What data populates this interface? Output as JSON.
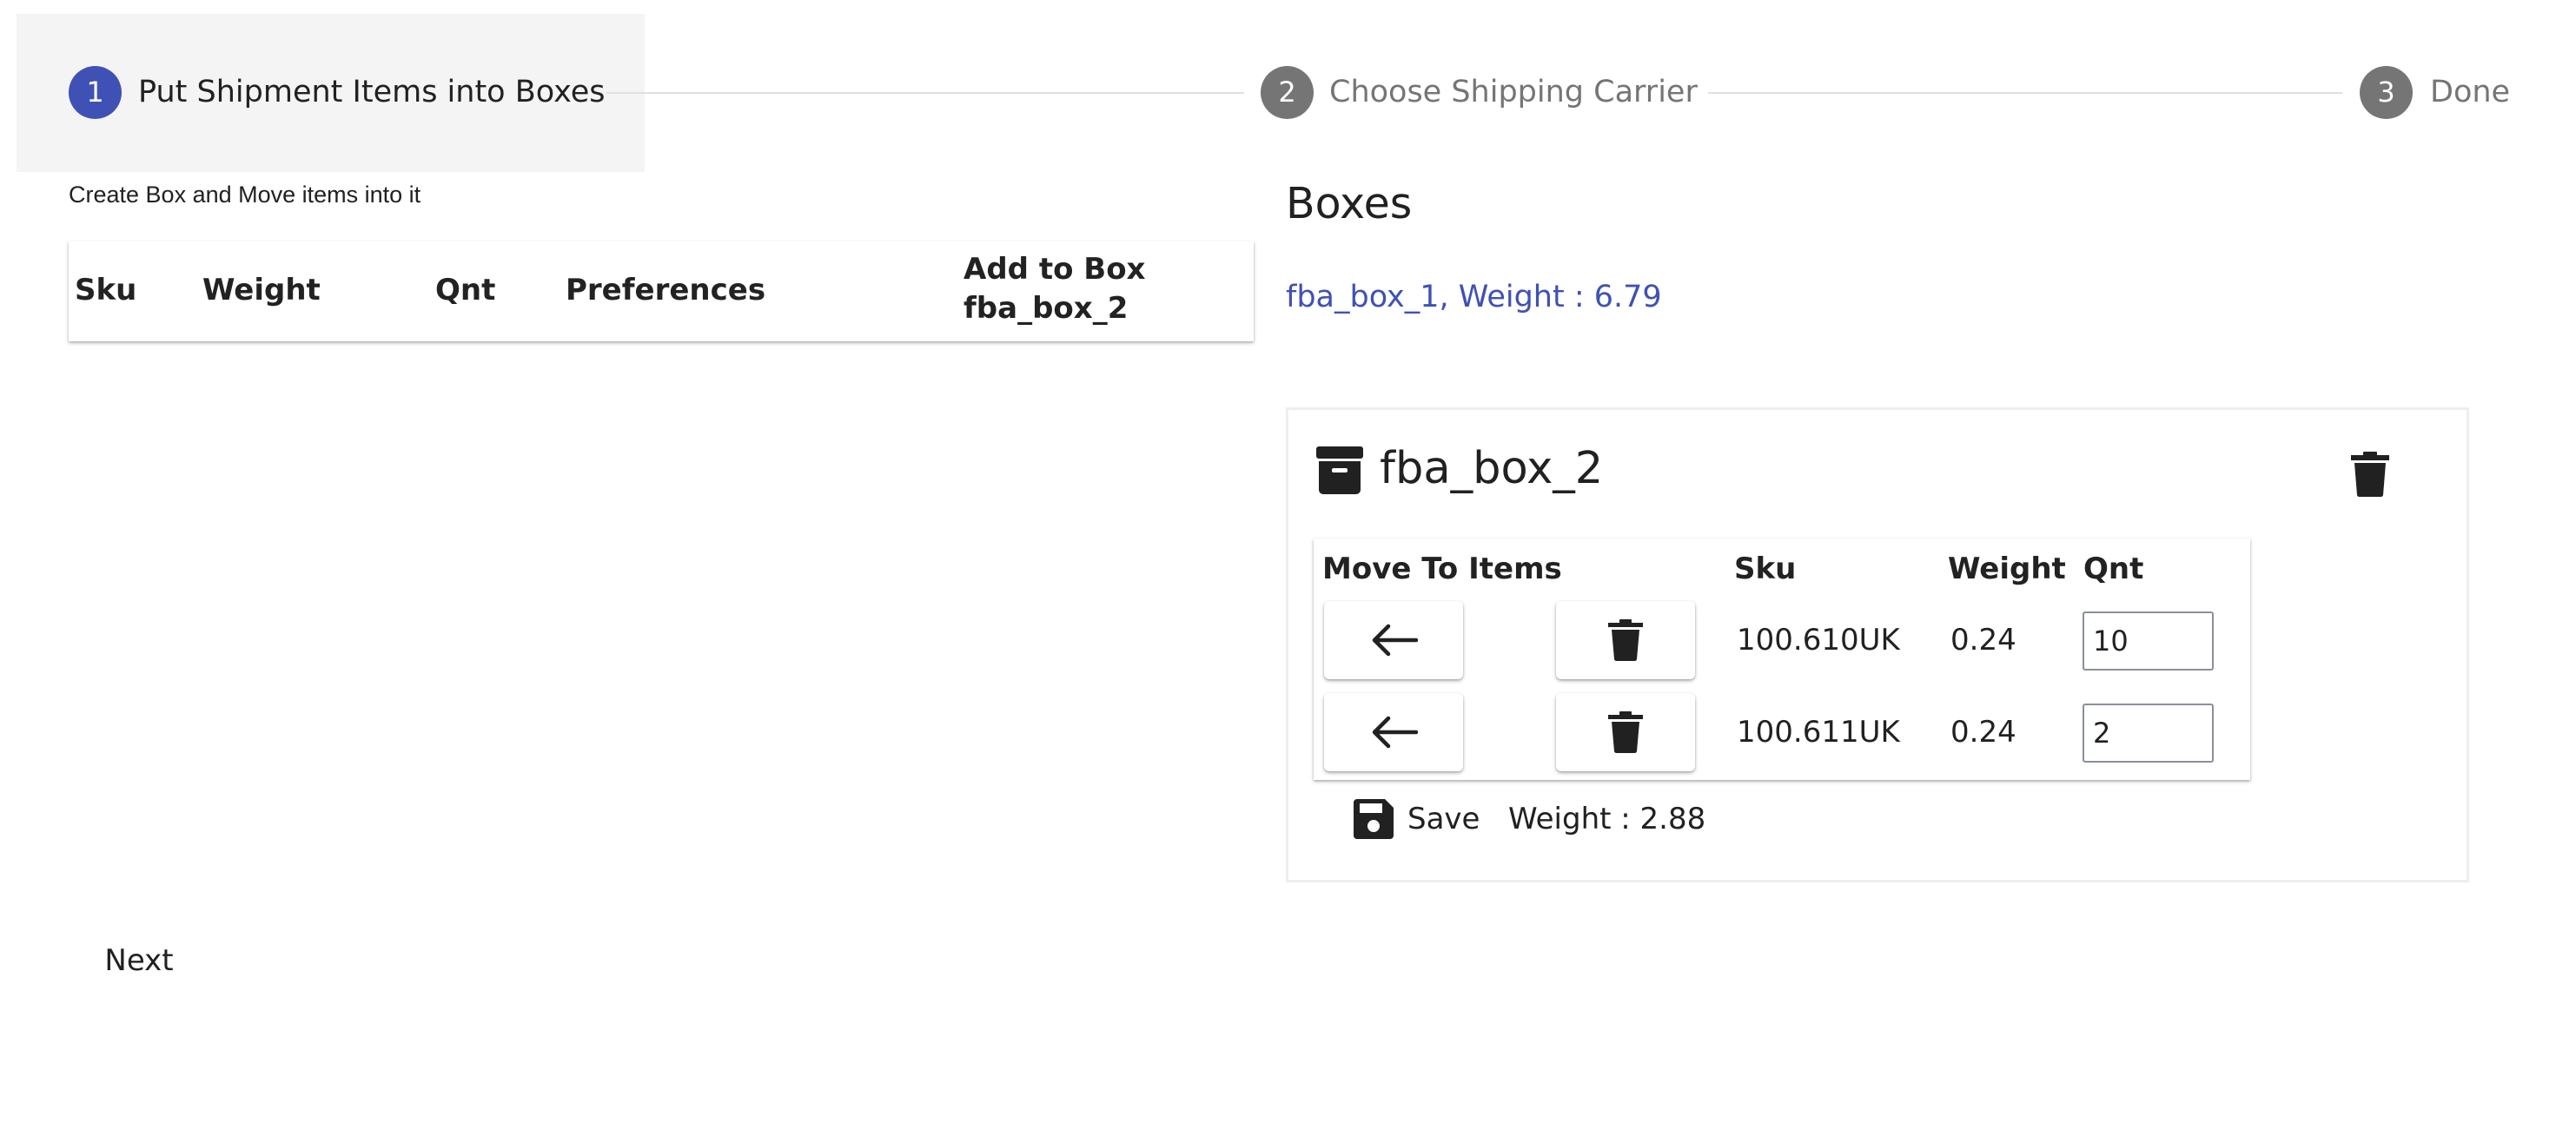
{
  "stepper": {
    "steps": [
      {
        "number": "1",
        "label": "Put Shipment Items into Boxes",
        "active": true
      },
      {
        "number": "2",
        "label": "Choose Shipping Carrier",
        "active": false
      },
      {
        "number": "3",
        "label": "Done",
        "active": false
      }
    ],
    "active_color": "#3f51b5",
    "inactive_color": "#757575"
  },
  "items_panel": {
    "caption": "Create Box and Move items into it",
    "columns": {
      "sku": "Sku",
      "weight": "Weight",
      "qnt": "Qnt",
      "preferences": "Preferences",
      "add_to_box_line1": "Add to Box",
      "add_to_box_line2": "fba_box_2"
    },
    "next_label": "Next"
  },
  "boxes_panel": {
    "title": "Boxes",
    "saved_boxes": [
      {
        "label": "fba_box_1, Weight : 6.79"
      }
    ],
    "current_box": {
      "name": "fba_box_2",
      "columns": {
        "move_to_items": "Move To Items",
        "sku": "Sku",
        "weight": "Weight",
        "qnt": "Qnt"
      },
      "rows": [
        {
          "sku": "100.610UK",
          "weight": "0.24",
          "qnt": "10"
        },
        {
          "sku": "100.611UK",
          "weight": "0.24",
          "qnt": "2"
        }
      ],
      "save_label": "Save",
      "weight_label": "Weight : 2.88"
    },
    "link_color": "#3f51b5"
  },
  "icons": {
    "box": "archive-box-icon",
    "delete": "trash-icon",
    "move_back": "arrow-left-icon",
    "save": "floppy-disk-icon"
  }
}
